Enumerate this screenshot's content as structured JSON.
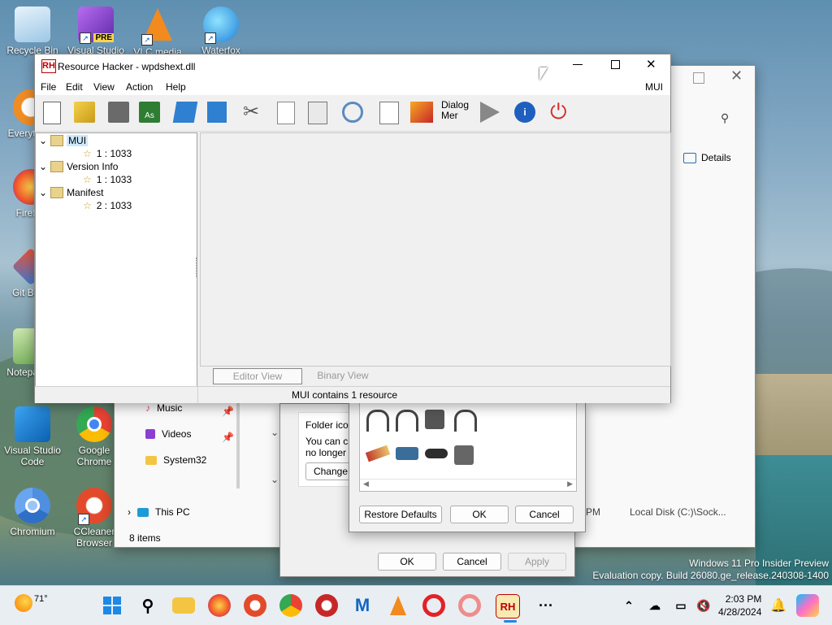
{
  "desktop_icons": [
    {
      "label": "Recycle Bin",
      "icon": "recycle-bin-icon"
    },
    {
      "label": "Visual Studio",
      "icon": "visual-studio-pre-icon",
      "badge": "PRE"
    },
    {
      "label": "VLC media",
      "icon": "vlc-icon"
    },
    {
      "label": "Waterfox",
      "icon": "waterfox-icon"
    },
    {
      "label": "Everything",
      "icon": "everything-icon"
    },
    {
      "label": "Firefox",
      "icon": "firefox-icon"
    },
    {
      "label": "Git Bash",
      "icon": "git-bash-icon"
    },
    {
      "label": "Notepad++",
      "icon": "notepad-plus-icon"
    },
    {
      "label": "Visual Studio Code",
      "icon": "vscode-icon"
    },
    {
      "label": "Google Chrome",
      "icon": "chrome-icon"
    },
    {
      "label": "Chromium",
      "icon": "chromium-icon"
    },
    {
      "label": "CCleaner Browser",
      "icon": "ccleaner-icon"
    }
  ],
  "rh": {
    "title": "Resource Hacker - wpdshext.dll",
    "menu": [
      "File",
      "Edit",
      "View",
      "Action",
      "Help"
    ],
    "menu_right": "MUI",
    "toolbar_dialog_label_1": "Dialog",
    "toolbar_dialog_label_2": "Mer",
    "tree": [
      {
        "label": "MUI",
        "child": "1 : 1033"
      },
      {
        "label": "Version Info",
        "child": "1 : 1033"
      },
      {
        "label": "Manifest",
        "child": "2 : 1033"
      }
    ],
    "tab_editor": "Editor View",
    "tab_binary": "Binary View",
    "status": "MUI contains 1 resource"
  },
  "explorer": {
    "details": "Details",
    "nav_music": "Music",
    "nav_videos": "Videos",
    "nav_system32": "System32",
    "nav_thispc": "This PC",
    "items_count": "8 items",
    "col_pm": "PM",
    "col_location": "Local Disk (C:)\\Sock..."
  },
  "props": {
    "folder_icons": "Folder icons",
    "you_can": "You can ch",
    "no_longer": "no longer sh",
    "change": "Change",
    "ok": "OK",
    "cancel": "Cancel",
    "apply": "Apply"
  },
  "icon_dialog": {
    "restore": "Restore Defaults",
    "ok": "OK",
    "cancel": "Cancel"
  },
  "watermark": {
    "line1": "Windows 11 Pro Insider Preview",
    "line2": "Evaluation copy. Build 26080.ge_release.240308-1400"
  },
  "taskbar": {
    "weather": "71°",
    "time": "2:03 PM",
    "date": "4/28/2024"
  }
}
